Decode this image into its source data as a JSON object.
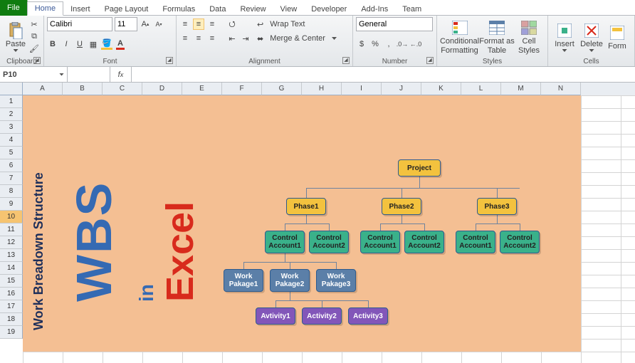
{
  "tabs": {
    "file": "File",
    "home": "Home",
    "insert": "Insert",
    "page_layout": "Page Layout",
    "formulas": "Formulas",
    "data": "Data",
    "review": "Review",
    "view": "View",
    "developer": "Developer",
    "addins": "Add-Ins",
    "team": "Team"
  },
  "ribbon": {
    "clipboard": {
      "label": "Clipboard",
      "paste": "Paste"
    },
    "font": {
      "label": "Font",
      "name": "Calibri",
      "size": "11",
      "bold": "B",
      "italic": "I",
      "underline": "U"
    },
    "alignment": {
      "label": "Alignment",
      "wrap": "Wrap Text",
      "merge": "Merge & Center"
    },
    "number": {
      "label": "Number",
      "format": "General",
      "currency": "$",
      "percent": "%",
      "comma": ","
    },
    "styles": {
      "label": "Styles",
      "cond": "Conditional",
      "cond2": "Formatting",
      "fat": "Format as",
      "fat2": "Table",
      "cell": "Cell",
      "cell2": "Styles"
    },
    "cells": {
      "label": "Cells",
      "insert": "Insert",
      "delete": "Delete",
      "format": "Form"
    }
  },
  "namebox": "P10",
  "cols": [
    "A",
    "B",
    "C",
    "D",
    "E",
    "F",
    "G",
    "H",
    "I",
    "J",
    "K",
    "L",
    "M",
    "N"
  ],
  "rows": [
    "1",
    "2",
    "3",
    "4",
    "5",
    "6",
    "7",
    "8",
    "9",
    "10",
    "11",
    "12",
    "13",
    "14",
    "15",
    "16",
    "17",
    "18",
    "19"
  ],
  "sel_row": "10",
  "diagram": {
    "sidebar": "Work Breadown Structure",
    "wbs": "WBS",
    "in": "in",
    "excel": "Excel",
    "project": "Project",
    "phase1": "Phase1",
    "phase2": "Phase2",
    "phase3": "Phase3",
    "ca1": "Control\nAccount1",
    "ca2": "Control\nAccount2",
    "wp1": "Work\nPakage1",
    "wp2": "Work\nPakage2",
    "wp3": "Work\nPakage3",
    "a1": "Avtivity1",
    "a2": "Activity2",
    "a3": "Activity3"
  }
}
